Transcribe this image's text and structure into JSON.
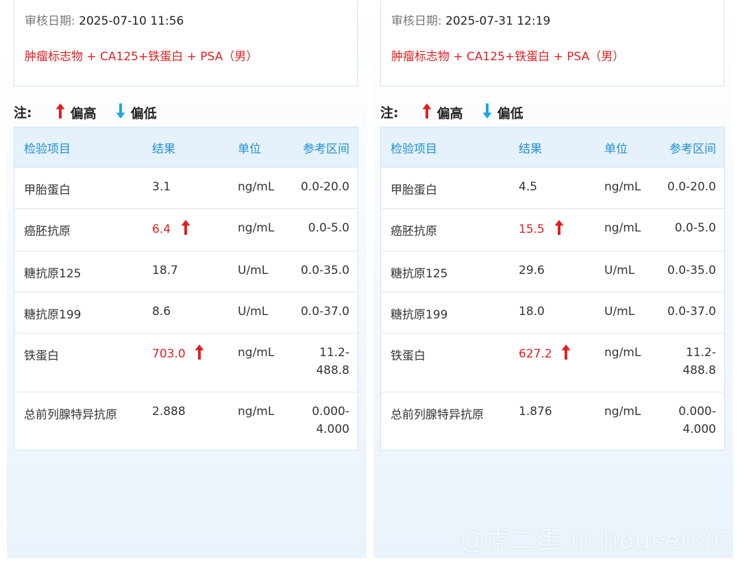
{
  "legend": {
    "note": "注:",
    "high": "偏高",
    "low": "偏低"
  },
  "columns": [
    "检验项目",
    "结果",
    "单位",
    "参考区间"
  ],
  "colors": {
    "high": "#e02020",
    "low": "#1fa3e6",
    "header_text": "#1f8fd3",
    "header_bg": "#e6f2fb"
  },
  "reports": [
    {
      "audit_label": "审核日期:",
      "audit_date": "2025-07-10 11:56",
      "test_name": "肿瘤标志物 + CA125+铁蛋白 + PSA（男）",
      "rows": [
        {
          "name": "甲胎蛋白",
          "value": "3.1",
          "unit": "ng/mL",
          "ref": [
            "0.0-20.0"
          ],
          "flag": ""
        },
        {
          "name": "癌胚抗原",
          "value": "6.4",
          "unit": "ng/mL",
          "ref": [
            "0.0-5.0"
          ],
          "flag": "high"
        },
        {
          "name": "糖抗原125",
          "value": "18.7",
          "unit": "U/mL",
          "ref": [
            "0.0-35.0"
          ],
          "flag": ""
        },
        {
          "name": "糖抗原199",
          "value": "8.6",
          "unit": "U/mL",
          "ref": [
            "0.0-37.0"
          ],
          "flag": ""
        },
        {
          "name": "铁蛋白",
          "value": "703.0",
          "unit": "ng/mL",
          "ref": [
            "11.2-",
            "488.8"
          ],
          "flag": "high"
        },
        {
          "name": "总前列腺特异抗原",
          "value": "2.888",
          "unit": "ng/mL",
          "ref": [
            "0.000-",
            "4.000"
          ],
          "flag": ""
        }
      ]
    },
    {
      "audit_label": "审核日期:",
      "audit_date": "2025-07-31 12:19",
      "test_name": "肿瘤标志物 + CA125+铁蛋白 + PSA（男）",
      "rows": [
        {
          "name": "甲胎蛋白",
          "value": "4.5",
          "unit": "ng/mL",
          "ref": [
            "0.0-20.0"
          ],
          "flag": ""
        },
        {
          "name": "癌胚抗原",
          "value": "15.5",
          "unit": "ng/mL",
          "ref": [
            "0.0-5.0"
          ],
          "flag": "high"
        },
        {
          "name": "糖抗原125",
          "value": "29.6",
          "unit": "U/mL",
          "ref": [
            "0.0-35.0"
          ],
          "flag": ""
        },
        {
          "name": "糖抗原199",
          "value": "18.0",
          "unit": "U/mL",
          "ref": [
            "0.0-37.0"
          ],
          "flag": ""
        },
        {
          "name": "铁蛋白",
          "value": "627.2",
          "unit": "ng/mL",
          "ref": [
            "11.2-",
            "488.8"
          ],
          "flag": "high"
        },
        {
          "name": "总前列腺特异抗原",
          "value": "1.876",
          "unit": "ng/mL",
          "ref": [
            "0.000-",
            "4.000"
          ],
          "flag": ""
        }
      ]
    }
  ],
  "watermark": "@虎二蛋 in house086"
}
